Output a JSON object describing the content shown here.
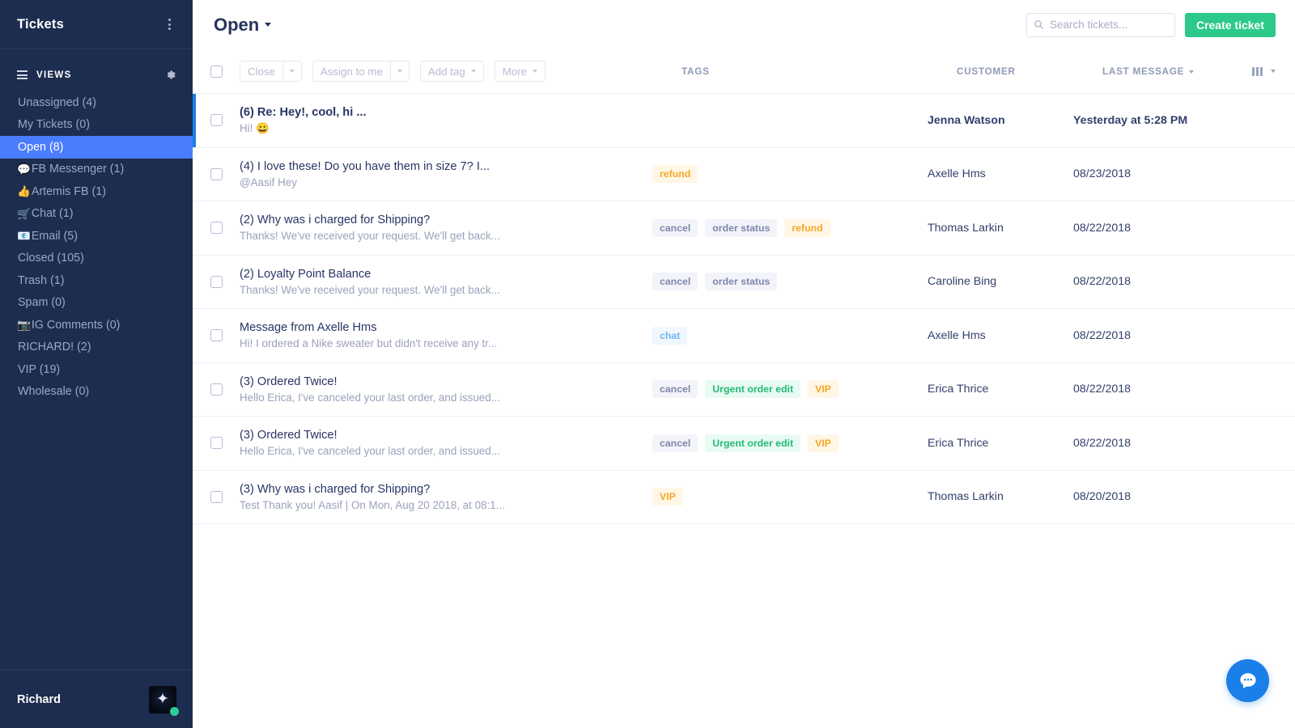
{
  "sidebar": {
    "title": "Tickets",
    "kebab_icon": "kebab-menu-icon",
    "views_label": "VIEWS",
    "views_icon": "list-icon",
    "settings_icon": "gear-icon",
    "items": [
      {
        "emoji": "",
        "label": "Unassigned (4)",
        "active": false
      },
      {
        "emoji": "",
        "label": "My Tickets (0)",
        "active": false
      },
      {
        "emoji": "",
        "label": "Open (8)",
        "active": true
      },
      {
        "emoji": "💬",
        "label": "FB Messenger (1)",
        "active": false
      },
      {
        "emoji": "👍",
        "label": "Artemis FB (1)",
        "active": false
      },
      {
        "emoji": "🛒",
        "label": "Chat (1)",
        "active": false
      },
      {
        "emoji": "📧",
        "label": "Email (5)",
        "active": false
      },
      {
        "emoji": "",
        "label": "Closed (105)",
        "active": false
      },
      {
        "emoji": "",
        "label": "Trash (1)",
        "active": false
      },
      {
        "emoji": "",
        "label": "Spam (0)",
        "active": false
      },
      {
        "emoji": "📷",
        "label": "IG Comments (0)",
        "active": false
      },
      {
        "emoji": "",
        "label": "RICHARD! (2)",
        "active": false
      },
      {
        "emoji": "",
        "label": "VIP (19)",
        "active": false
      },
      {
        "emoji": "",
        "label": "Wholesale (0)",
        "active": false
      }
    ],
    "user": {
      "name": "Richard",
      "avatar_glyph": "✦",
      "status_color": "#2ecc9a"
    }
  },
  "topbar": {
    "view_title": "Open",
    "search_placeholder": "Search tickets...",
    "search_value": "",
    "search_icon": "search-icon",
    "create_label": "Create ticket",
    "create_color": "#2cc98a"
  },
  "toolbar": {
    "close_label": "Close",
    "assign_label": "Assign to me",
    "addtag_label": "Add tag",
    "more_label": "More"
  },
  "columns": {
    "tags": "TAGS",
    "customer": "CUSTOMER",
    "last_message": "LAST MESSAGE",
    "options_icon": "columns-icon"
  },
  "rows": [
    {
      "subject": "(6) Re: Hey!, cool, hi ...",
      "snippet": "Hi! 😀",
      "tags": [],
      "customer": "Jenna Watson",
      "last_message": "Yesterday at 5:28 PM",
      "unread": true
    },
    {
      "subject": "(4) I love these! Do you have them in size 7? I...",
      "snippet": "@Aasif Hey",
      "tags": [
        {
          "label": "refund",
          "color": "orange"
        }
      ],
      "customer": "Axelle Hms",
      "last_message": "08/23/2018",
      "unread": false
    },
    {
      "subject": "(2) Why was i charged for Shipping?",
      "snippet": "Thanks! We've received your request. We'll get back...",
      "tags": [
        {
          "label": "cancel",
          "color": "grey"
        },
        {
          "label": "order status",
          "color": "grey"
        },
        {
          "label": "refund",
          "color": "orange"
        }
      ],
      "customer": "Thomas Larkin",
      "last_message": "08/22/2018",
      "unread": false
    },
    {
      "subject": "(2) Loyalty Point Balance",
      "snippet": "Thanks! We've received your request. We'll get back...",
      "tags": [
        {
          "label": "cancel",
          "color": "grey"
        },
        {
          "label": "order status",
          "color": "grey"
        }
      ],
      "customer": "Caroline Bing",
      "last_message": "08/22/2018",
      "unread": false
    },
    {
      "subject": "Message from Axelle Hms",
      "snippet": "Hi! I ordered a Nike sweater but didn't receive any tr...",
      "tags": [
        {
          "label": "chat",
          "color": "blue"
        }
      ],
      "customer": "Axelle Hms",
      "last_message": "08/22/2018",
      "unread": false
    },
    {
      "subject": "(3) Ordered Twice!",
      "snippet": "Hello Erica, I've canceled your last order, and issued...",
      "tags": [
        {
          "label": "cancel",
          "color": "grey"
        },
        {
          "label": "Urgent order edit",
          "color": "green"
        },
        {
          "label": "VIP",
          "color": "orange"
        }
      ],
      "customer": "Erica Thrice",
      "last_message": "08/22/2018",
      "unread": false
    },
    {
      "subject": "(3) Ordered Twice!",
      "snippet": "Hello Erica, I've canceled your last order, and issued...",
      "tags": [
        {
          "label": "cancel",
          "color": "grey"
        },
        {
          "label": "Urgent order edit",
          "color": "green"
        },
        {
          "label": "VIP",
          "color": "orange"
        }
      ],
      "customer": "Erica Thrice",
      "last_message": "08/22/2018",
      "unread": false
    },
    {
      "subject": "(3) Why was i charged for Shipping?",
      "snippet": "Test Thank you! Aasif | On Mon, Aug 20 2018, at 08:1...",
      "tags": [
        {
          "label": "VIP",
          "color": "orange"
        }
      ],
      "customer": "Thomas Larkin",
      "last_message": "08/20/2018",
      "unread": false
    }
  ],
  "chat_widget": {
    "icon": "chat-bubble-icon",
    "color": "#1a7fe8"
  }
}
